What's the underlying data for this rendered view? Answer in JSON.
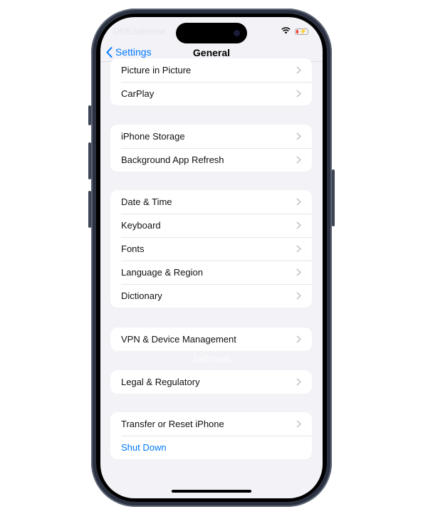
{
  "status_bar": {
    "carrier_watermark": "ONEJailbreak",
    "wifi_icon": "wifi-icon",
    "battery_icon": "battery-charging-low-icon"
  },
  "nav": {
    "back_label": "Settings",
    "title": "General"
  },
  "groups": [
    {
      "items": [
        {
          "label": "Picture in Picture"
        },
        {
          "label": "CarPlay"
        }
      ]
    },
    {
      "items": [
        {
          "label": "iPhone Storage"
        },
        {
          "label": "Background App Refresh"
        }
      ]
    },
    {
      "items": [
        {
          "label": "Date & Time"
        },
        {
          "label": "Keyboard"
        },
        {
          "label": "Fonts"
        },
        {
          "label": "Language & Region"
        },
        {
          "label": "Dictionary"
        }
      ]
    },
    {
      "items": [
        {
          "label": "VPN & Device Management"
        }
      ]
    },
    {
      "items": [
        {
          "label": "Legal & Regulatory"
        }
      ]
    },
    {
      "items": [
        {
          "label": "Transfer or Reset iPhone"
        },
        {
          "label": "Shut Down"
        }
      ]
    }
  ],
  "watermark": "Jailbreak",
  "colors": {
    "accent": "#007aff",
    "background": "#f2f2f7"
  }
}
